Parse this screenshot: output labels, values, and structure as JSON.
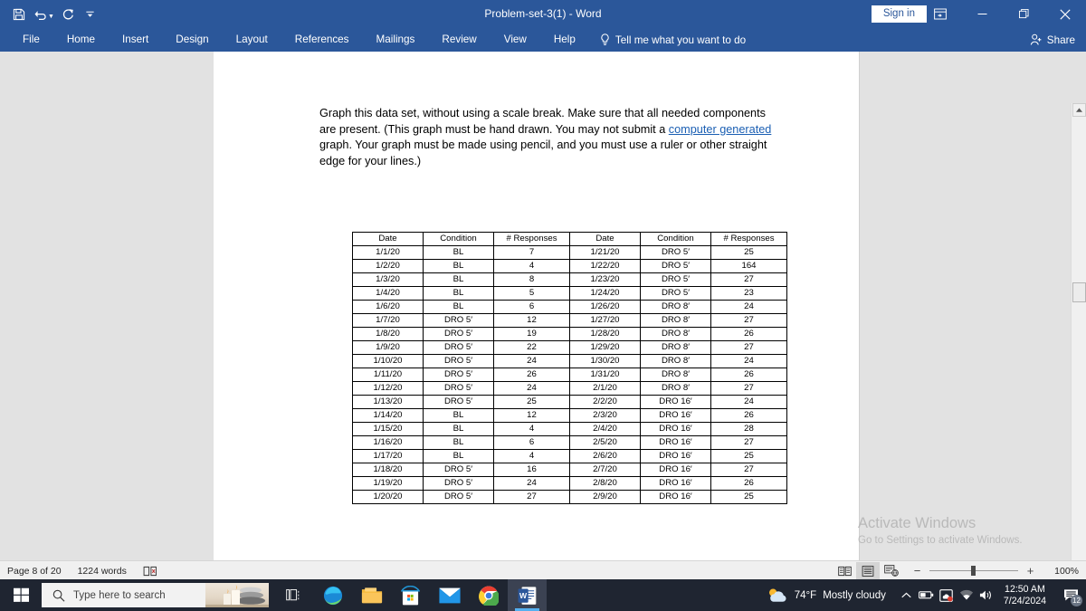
{
  "window": {
    "title": "Problem-set-3(1)  -  Word",
    "signin_label": "Sign in",
    "ribbon_display_icon": "ribbon-display-options-icon",
    "minimize_icon": "minimize-icon",
    "restore_icon": "restore-icon",
    "close_icon": "close-icon"
  },
  "quick_access": {
    "save_icon": "save-icon",
    "undo_icon": "undo-icon",
    "redo_icon": "redo-icon",
    "customize_icon": "customize-quick-access-toolbar-icon"
  },
  "ribbon": {
    "tabs": [
      {
        "label": "File"
      },
      {
        "label": "Home"
      },
      {
        "label": "Insert"
      },
      {
        "label": "Design"
      },
      {
        "label": "Layout"
      },
      {
        "label": "References"
      },
      {
        "label": "Mailings"
      },
      {
        "label": "Review"
      },
      {
        "label": "View"
      },
      {
        "label": "Help"
      }
    ],
    "tell_me": "Tell me what you want to do",
    "tell_me_icon": "lightbulb-icon",
    "share_label": "Share",
    "share_icon": "share-person-icon"
  },
  "document": {
    "paragraph": {
      "part1": "Graph this data set, without using a scale break.  Make sure that all needed components are present.  (This graph must be hand drawn.  You may not submit a ",
      "link1": "computer generated",
      "part2": " graph.  Your graph must be made using pencil, and you must use a ruler or other straight edge for your lines.)"
    },
    "table": {
      "headers": [
        "Date",
        "Condition",
        "# Responses",
        "Date",
        "Condition",
        "# Responses"
      ],
      "rows": [
        [
          "1/1/20",
          "BL",
          "7",
          "1/21/20",
          "DRO 5′",
          "25"
        ],
        [
          "1/2/20",
          "BL",
          "4",
          "1/22/20",
          "DRO 5′",
          "164"
        ],
        [
          "1/3/20",
          "BL",
          "8",
          "1/23/20",
          "DRO 5′",
          "27"
        ],
        [
          "1/4/20",
          "BL",
          "5",
          "1/24/20",
          "DRO 5′",
          "23"
        ],
        [
          "1/6/20",
          "BL",
          "6",
          "1/26/20",
          "DRO 8′",
          "24"
        ],
        [
          "1/7/20",
          "DRO 5′",
          "12",
          "1/27/20",
          "DRO 8′",
          "27"
        ],
        [
          "1/8/20",
          "DRO 5′",
          "19",
          "1/28/20",
          "DRO 8′",
          "26"
        ],
        [
          "1/9/20",
          "DRO 5′",
          "22",
          "1/29/20",
          "DRO 8′",
          "27"
        ],
        [
          "1/10/20",
          "DRO 5′",
          "24",
          "1/30/20",
          "DRO 8′",
          "24"
        ],
        [
          "1/11/20",
          "DRO 5′",
          "26",
          "1/31/20",
          "DRO 8′",
          "26"
        ],
        [
          "1/12/20",
          "DRO 5′",
          "24",
          "2/1/20",
          "DRO 8′",
          "27"
        ],
        [
          "1/13/20",
          "DRO 5′",
          "25",
          "2/2/20",
          "DRO 16′",
          "24"
        ],
        [
          "1/14/20",
          "BL",
          "12",
          "2/3/20",
          "DRO 16′",
          "26"
        ],
        [
          "1/15/20",
          "BL",
          "4",
          "2/4/20",
          "DRO 16′",
          "28"
        ],
        [
          "1/16/20",
          "BL",
          "6",
          "2/5/20",
          "DRO 16′",
          "27"
        ],
        [
          "1/17/20",
          "BL",
          "4",
          "2/6/20",
          "DRO 16′",
          "25"
        ],
        [
          "1/18/20",
          "DRO 5′",
          "16",
          "2/7/20",
          "DRO 16′",
          "27"
        ],
        [
          "1/19/20",
          "DRO 5′",
          "24",
          "2/8/20",
          "DRO 16′",
          "26"
        ],
        [
          "1/20/20",
          "DRO 5′",
          "27",
          "2/9/20",
          "DRO 16′",
          "25"
        ]
      ]
    }
  },
  "watermark": {
    "line1": "Activate Windows",
    "line2": "Go to Settings to activate Windows."
  },
  "status_bar": {
    "page_label": "Page 8 of 20",
    "word_count": "1224 words",
    "proofing_icon": "proofing-errors-icon",
    "view_read_mode_icon": "read-mode-icon",
    "view_print_layout_icon": "print-layout-icon",
    "view_web_layout_icon": "web-layout-icon",
    "zoom_out_label": "−",
    "zoom_in_label": "+",
    "zoom_level": "100%"
  },
  "taskbar": {
    "start_icon": "windows-start-icon",
    "search_placeholder": "Type here to search",
    "search_icon": "search-icon",
    "items": [
      {
        "name": "task-view-icon"
      },
      {
        "name": "edge-icon"
      },
      {
        "name": "file-explorer-icon"
      },
      {
        "name": "microsoft-store-icon"
      },
      {
        "name": "mail-icon"
      },
      {
        "name": "chrome-icon"
      },
      {
        "name": "word-icon"
      }
    ],
    "weather_temp": "74°F",
    "weather_desc": "Mostly cloudy",
    "weather_icon": "partly-cloudy-icon",
    "tray_chevron_icon": "show-hidden-icons-icon",
    "tray_battery_icon": "battery-icon",
    "tray_onedrive_icon": "onedrive-icon",
    "tray_network_icon": "wifi-icon",
    "tray_volume_icon": "volume-icon",
    "clock_time": "12:50 AM",
    "clock_date": "7/24/2024",
    "notification_icon": "notifications-icon",
    "notification_count": "12"
  },
  "colors": {
    "word_blue": "#2b579a",
    "canvas_gray": "#e2e2e2",
    "taskbar": "#1f2531",
    "accent_link": "#1b5fb3"
  }
}
